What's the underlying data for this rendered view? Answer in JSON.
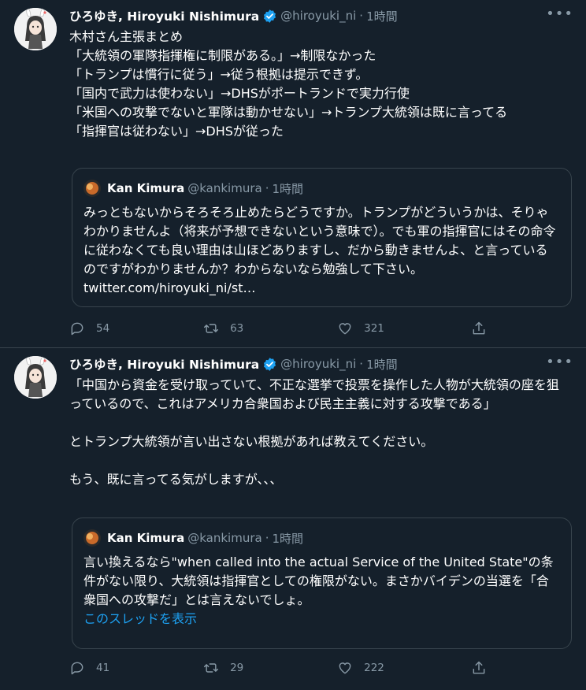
{
  "tweets": [
    {
      "name": "ひろゆき, Hiroyuki Nishimura",
      "handle": "@hiroyuki_ni",
      "dot": "·",
      "time": "1時間",
      "more": "•••",
      "body_lines": [
        "木村さん主張まとめ",
        "「大統領の軍隊指揮権に制限がある。」→制限なかった",
        "「トランプは慣行に従う」→従う根拠は提示できず。",
        "「国内で武力は使わない」→DHSがポートランドで実力行使",
        "「米国への攻撃でないと軍隊は動かせない」→トランプ大統領は既に言ってる",
        "「指揮官は従わない」→DHSが従った"
      ],
      "quote": {
        "name": "Kan Kimura",
        "handle": "@kankimura",
        "dot": "·",
        "time": "1時間",
        "text": "みっともないからそろそろ止めたらどうですか。トランプがどういうかは、そりゃわかりませんよ（将来が予想できないという意味で）。でも軍の指揮官にはその命令に従わなくても良い理由は山ほどありますし、だから動きませんよ、と言っているのですがわかりませんか？わからないなら勉強して下さい。 twitter.com/hiroyuki_ni/st…"
      },
      "stats": {
        "replies": "54",
        "retweets": "63",
        "likes": "321"
      }
    },
    {
      "name": "ひろゆき, Hiroyuki Nishimura",
      "handle": "@hiroyuki_ni",
      "dot": "·",
      "time": "1時間",
      "more": "•••",
      "body_p1": "「中国から資金を受け取っていて、不正な選挙で投票を操作した人物が大統領の座を狙っているので、これはアメリカ合衆国および民主主義に対する攻撃である」",
      "body_p2": "とトランプ大統領が言い出さない根拠があれば教えてください。",
      "body_p3": "もう、既に言ってる気がしますが、、、",
      "quote": {
        "name": "Kan Kimura",
        "handle": "@kankimura",
        "dot": "·",
        "time": "1時間",
        "text": "言い換えるなら\"when called into the actual Service of the United State\"の条件がない限り、大統領は指揮官としての権限がない。まさかバイデンの当選を「合衆国への攻撃だ」とは言えないでしょ。",
        "show_thread": "このスレッドを表示"
      },
      "stats": {
        "replies": "41",
        "retweets": "29",
        "likes": "222"
      }
    }
  ],
  "colors": {
    "background": "#15202b",
    "border": "#38444d",
    "secondary_text": "#8899a6",
    "link": "#1da1f2",
    "verified": "#1da1f2"
  },
  "icons": [
    "reply-icon",
    "retweet-icon",
    "like-icon",
    "share-icon",
    "verified-badge-icon",
    "more-icon"
  ]
}
